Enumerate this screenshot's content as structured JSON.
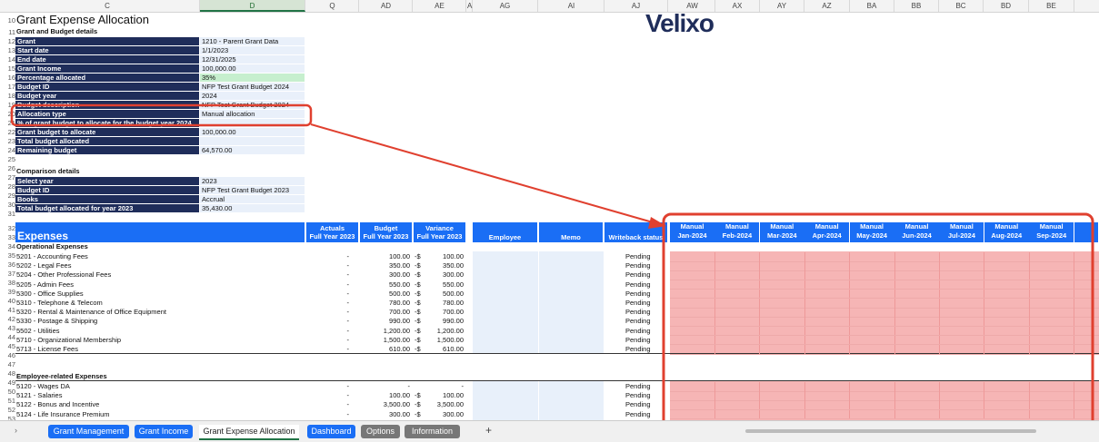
{
  "columns": [
    "C",
    "D",
    "Q",
    "AD",
    "AE",
    "A",
    "AG",
    "AI",
    "AJ",
    "AW",
    "AX",
    "AY",
    "AZ",
    "BA",
    "BB",
    "BC",
    "BD",
    "BE"
  ],
  "title": "Grant Expense Allocation",
  "logo": "Velixo",
  "grant_section": {
    "heading": "Grant and Budget details",
    "rows": [
      {
        "label": "Grant",
        "value": "1210 - Parent Grant Data"
      },
      {
        "label": "Start date",
        "value": "1/1/2023"
      },
      {
        "label": "End date",
        "value": "12/31/2025"
      },
      {
        "label": "Grant Income",
        "value": "100,000.00"
      },
      {
        "label": "Percentage allocated",
        "value": "35%"
      },
      {
        "label": "Budget ID",
        "value": "NFP Test Grant Budget 2024"
      },
      {
        "label": "Budget year",
        "value": "2024"
      },
      {
        "label": "Budget description",
        "value": "NFP Test Grant Budget 2024"
      },
      {
        "label": "Allocation type",
        "value": "Manual allocation"
      },
      {
        "label": "% of grant budget to allocate for the budget year 2024",
        "value": ""
      },
      {
        "label": "Grant budget to allocate",
        "value": "100,000.00"
      },
      {
        "label": "Total budget allocated",
        "value": ""
      },
      {
        "label": "Remaining budget",
        "value": "64,570.00"
      }
    ]
  },
  "comparison": {
    "heading": "Comparison details",
    "rows": [
      {
        "label": "Select year",
        "value": "2023"
      },
      {
        "label": "Budget ID",
        "value": "NFP Test Grant Budget 2023"
      },
      {
        "label": "Books",
        "value": "Accrual"
      },
      {
        "label": "Total budget allocated for year 2023",
        "value": "35,430.00"
      }
    ]
  },
  "expenses_header": {
    "title": "Expenses",
    "actuals": [
      "Actuals",
      "Full Year 2023"
    ],
    "budget": [
      "Budget",
      "Full Year 2023"
    ],
    "variance": [
      "Variance",
      "Full Year 2023"
    ],
    "employee": "Employee",
    "memo": "Memo",
    "writeback": "Writeback status",
    "months": [
      [
        "Manual",
        "Jan-2024"
      ],
      [
        "Manual",
        "Feb-2024"
      ],
      [
        "Manual",
        "Mar-2024"
      ],
      [
        "Manual",
        "Apr-2024"
      ],
      [
        "Manual",
        "May-2024"
      ],
      [
        "Manual",
        "Jun-2024"
      ],
      [
        "Manual",
        "Jul-2024"
      ],
      [
        "Manual",
        "Aug-2024"
      ],
      [
        "Manual",
        "Sep-2024"
      ]
    ]
  },
  "operational": {
    "heading": "Operational Expenses",
    "rows": [
      {
        "name": "5201 - Accounting Fees",
        "actual": "-",
        "budget": "100.00",
        "var": "100.00",
        "status": "Pending"
      },
      {
        "name": "5202 - Legal Fees",
        "actual": "-",
        "budget": "350.00",
        "var": "350.00",
        "status": "Pending"
      },
      {
        "name": "5204 - Other Professional Fees",
        "actual": "-",
        "budget": "300.00",
        "var": "300.00",
        "status": "Pending"
      },
      {
        "name": "5205 - Admin Fees",
        "actual": "-",
        "budget": "550.00",
        "var": "550.00",
        "status": "Pending"
      },
      {
        "name": "5300 - Office Supplies",
        "actual": "-",
        "budget": "500.00",
        "var": "500.00",
        "status": "Pending"
      },
      {
        "name": "5310 - Telephone & Telecom",
        "actual": "-",
        "budget": "780.00",
        "var": "780.00",
        "status": "Pending"
      },
      {
        "name": "5320 - Rental & Maintenance of Office Equipment",
        "actual": "-",
        "budget": "700.00",
        "var": "700.00",
        "status": "Pending"
      },
      {
        "name": "5330 - Postage & Shipping",
        "actual": "-",
        "budget": "990.00",
        "var": "990.00",
        "status": "Pending"
      },
      {
        "name": "5502 - Utilities",
        "actual": "-",
        "budget": "1,200.00",
        "var": "1,200.00",
        "status": "Pending"
      },
      {
        "name": "5710 - Organizational Membership",
        "actual": "-",
        "budget": "1,500.00",
        "var": "1,500.00",
        "status": "Pending"
      },
      {
        "name": "5713 - License Fees",
        "actual": "-",
        "budget": "610.00",
        "var": "610.00",
        "status": "Pending"
      }
    ]
  },
  "employee_related": {
    "heading": "Employee-related Expenses",
    "rows": [
      {
        "name": "5120 - Wages DA",
        "actual": "-",
        "budget": "-",
        "var": "-",
        "status": "Pending"
      },
      {
        "name": "5121 - Salaries",
        "actual": "-",
        "budget": "100.00",
        "var": "100.00",
        "status": "Pending"
      },
      {
        "name": "5122 - Bonus and Incentive",
        "actual": "-",
        "budget": "3,500.00",
        "var": "3,500.00",
        "status": "Pending"
      },
      {
        "name": "5124 - Life Insurance Premium",
        "actual": "-",
        "budget": "300.00",
        "var": "300.00",
        "status": "Pending"
      }
    ]
  },
  "var_prefix": "-$",
  "row_numbers": [
    "10",
    "11",
    "12",
    "13",
    "14",
    "15",
    "16",
    "17",
    "18",
    "19",
    "20",
    "21",
    "22",
    "23",
    "24",
    "25",
    "26",
    "27",
    "28",
    "29",
    "30",
    "31",
    "32",
    "33",
    "34",
    "35",
    "36",
    "37",
    "38",
    "39",
    "40",
    "41",
    "42",
    "43",
    "44",
    "45",
    "46",
    "47",
    "48",
    "49",
    "50",
    "51",
    "52",
    "53"
  ],
  "tabs": [
    {
      "label": "Grant Management",
      "style": "blue"
    },
    {
      "label": "Grant Income",
      "style": "blue"
    },
    {
      "label": "Grant Expense Allocation",
      "style": "active"
    },
    {
      "label": "Dashboard",
      "style": "blue"
    },
    {
      "label": "Options",
      "style": "gray"
    },
    {
      "label": "Information",
      "style": "gray"
    }
  ],
  "add_sheet": "+",
  "annotation_color": "#e0402f"
}
